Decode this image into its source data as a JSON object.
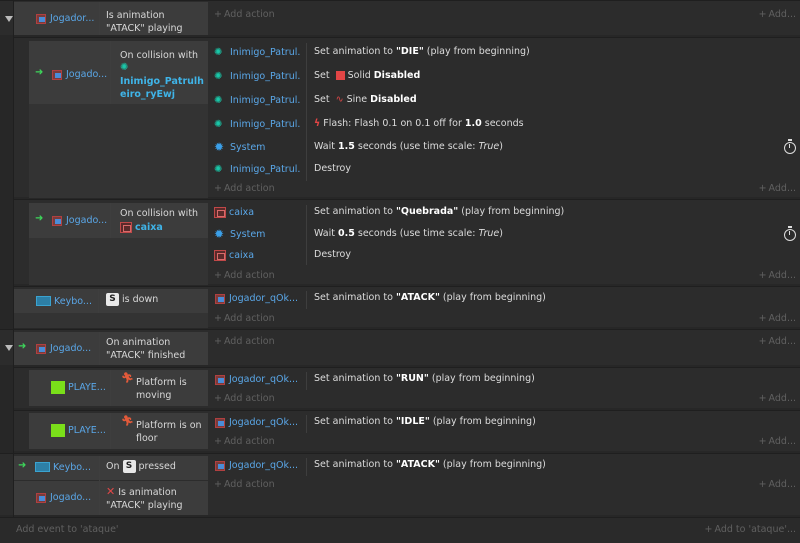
{
  "events": [
    {
      "conditions": [
        {
          "object": "Jogador...",
          "text": "Is animation \"ATACK\" playing"
        }
      ],
      "add_action": "Add action",
      "add_right": "Add..."
    },
    {
      "conditions": [
        {
          "object": "Jogado...",
          "text": "On collision with",
          "target": "Inimigo_Patrulheiro_ryEwj"
        }
      ],
      "actions": [
        {
          "object": "Inimigo_Patrul...",
          "pre": "Set animation to ",
          "bold": "\"DIE\"",
          "post": " (play from beginning)"
        },
        {
          "object": "Inimigo_Patrul...",
          "pre": "Set ",
          "mid": "Solid ",
          "bold": "Disabled"
        },
        {
          "object": "Inimigo_Patrul...",
          "pre": "Set ",
          "mid": "Sine ",
          "bold": "Disabled"
        },
        {
          "object": "Inimigo_Patrul...",
          "pre": "Flash: Flash 0.1 on 0.1 off for ",
          "bold": "1.0",
          "post": " seconds"
        },
        {
          "object": "System",
          "pre": "Wait ",
          "bold": "1.5",
          "post": " seconds (use time scale: ",
          "italic": "True",
          "end": ")"
        },
        {
          "object": "Inimigo_Patrul...",
          "pre": "Destroy"
        }
      ],
      "add_action": "Add action",
      "add_right": "Add..."
    },
    {
      "conditions": [
        {
          "object": "Jogado...",
          "text": "On collision with",
          "target": "caixa"
        }
      ],
      "actions": [
        {
          "object": "caixa",
          "pre": "Set animation to ",
          "bold": "\"Quebrada\"",
          "post": " (play from beginning)"
        },
        {
          "object": "System",
          "pre": "Wait ",
          "bold": "0.5",
          "post": " seconds (use time scale: ",
          "italic": "True",
          "end": ")"
        },
        {
          "object": "caixa",
          "pre": "Destroy"
        }
      ],
      "add_action": "Add action",
      "add_right": "Add..."
    },
    {
      "conditions": [
        {
          "object": "Keybo...",
          "key": "S",
          "text": "is down"
        }
      ],
      "actions": [
        {
          "object": "Jogador_qOk...",
          "pre": "Set animation to ",
          "bold": "\"ATACK\"",
          "post": " (play from beginning)"
        }
      ],
      "add_action": "Add action",
      "add_right": "Add..."
    },
    {
      "conditions": [
        {
          "object": "Jogado...",
          "text": "On animation \"ATACK\" finished"
        }
      ],
      "add_action": "Add action",
      "add_right": "Add..."
    },
    {
      "conditions": [
        {
          "object": "PLAYE...",
          "text": "Platform is moving"
        }
      ],
      "actions": [
        {
          "object": "Jogador_qOk...",
          "pre": "Set animation to ",
          "bold": "\"RUN\"",
          "post": " (play from beginning)"
        }
      ],
      "add_action": "Add action",
      "add_right": "Add..."
    },
    {
      "conditions": [
        {
          "object": "PLAYE...",
          "text": "Platform is on floor"
        }
      ],
      "actions": [
        {
          "object": "Jogador_qOk...",
          "pre": "Set animation to ",
          "bold": "\"IDLE\"",
          "post": " (play from beginning)"
        }
      ],
      "add_action": "Add action",
      "add_right": "Add..."
    },
    {
      "conditions": [
        {
          "object": "Keybo...",
          "pre": "On",
          "key": "S",
          "text": "pressed"
        },
        {
          "object": "Jogado...",
          "text": "Is animation \"ATACK\" playing"
        }
      ],
      "actions": [
        {
          "object": "Jogador_qOk...",
          "pre": "Set animation to ",
          "bold": "\"ATACK\"",
          "post": " (play from beginning)"
        }
      ],
      "add_action": "Add action",
      "add_right": "Add..."
    }
  ],
  "footer": {
    "add_event": "Add event to 'ataque'",
    "add_to": "Add to 'ataque'..."
  }
}
